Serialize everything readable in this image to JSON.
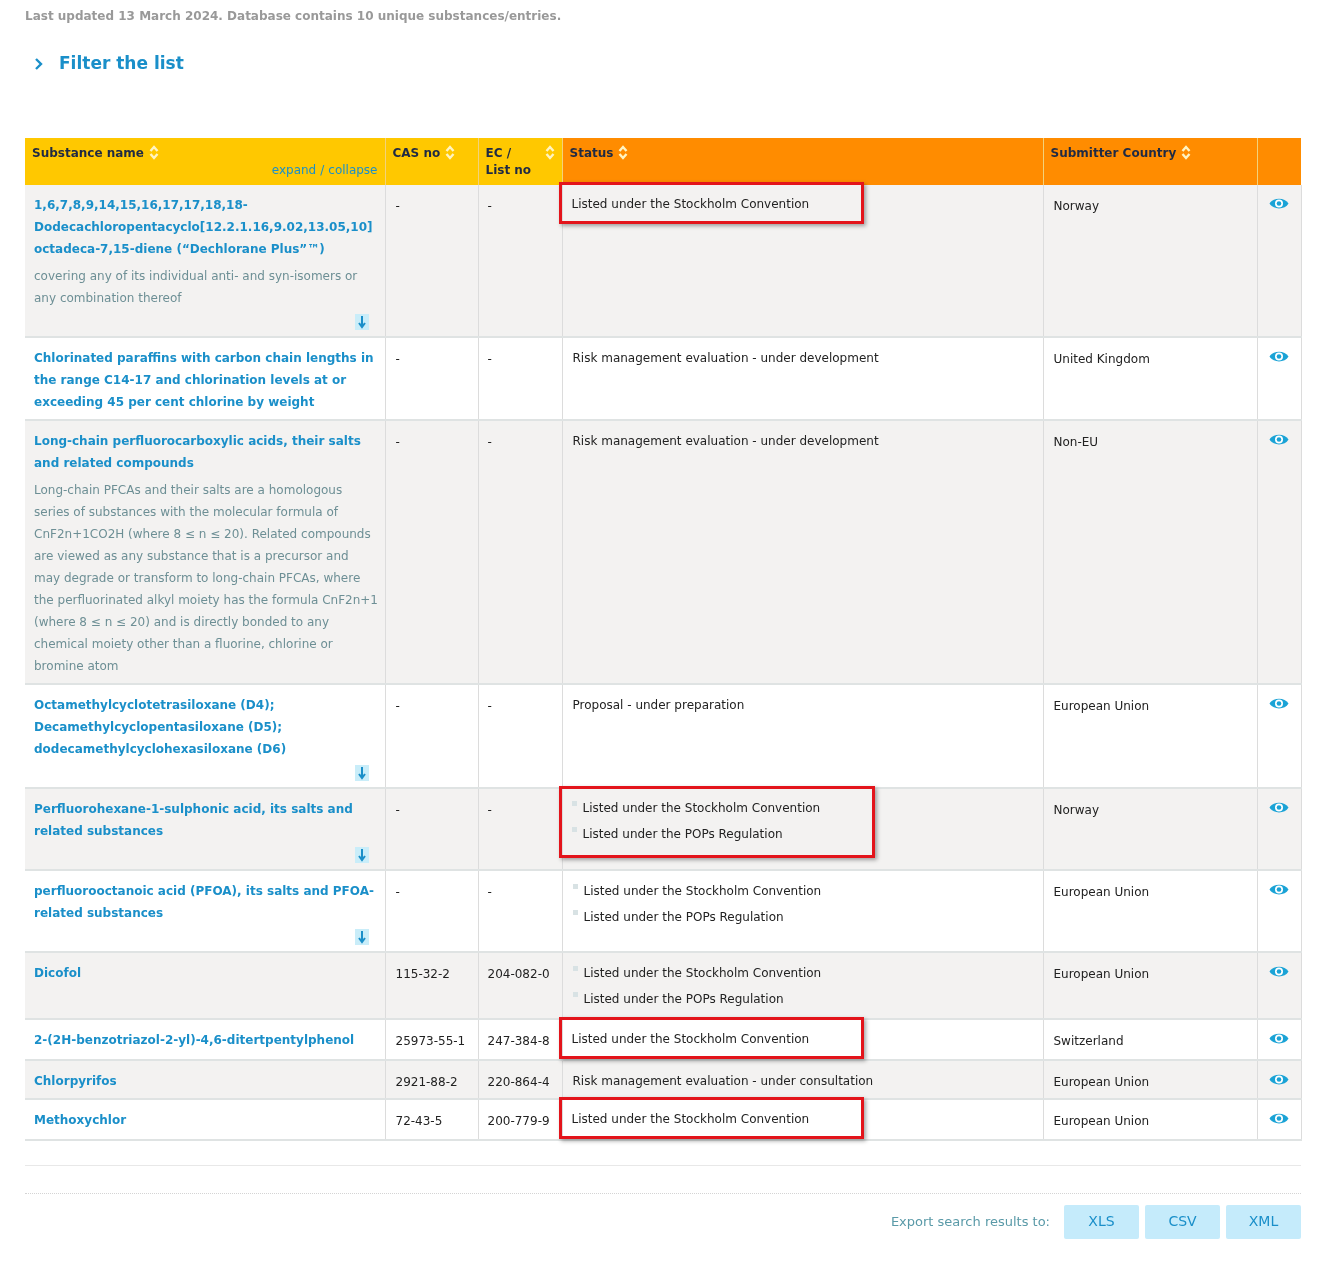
{
  "update_note": "Last updated 13 March 2024. Database contains 10 unique substances/entries.",
  "filter": {
    "label": "Filter the list",
    "expanded": false
  },
  "table": {
    "columns": [
      {
        "label": "Substance name",
        "kind": "name",
        "color": "#ffc800",
        "sortable": true
      },
      {
        "label": "CAS no",
        "kind": "cas",
        "color": "#ffc800",
        "sortable": true
      },
      {
        "label": "EC / List no",
        "kind": "ec",
        "color": "#ffc800",
        "sortable": true
      },
      {
        "label": "Status",
        "kind": "status",
        "color": "#ff8c00",
        "sortable": true
      },
      {
        "label": "Submitter Country",
        "kind": "country",
        "color": "#ff8c00",
        "sortable": true
      }
    ],
    "expand_link": "expand",
    "separator": "/",
    "collapse_link": "collapse",
    "rows": [
      {
        "name": "1,6,7,8,9,14,15,16,17,17,18,18-Dodecachloropentacyclo[12.2.1.16,9.02,13.05,10]octadeca-7,15-diene (“Dechlorane Plus”™)",
        "description": "covering any of its individual anti- and syn-isomers or any combination thereof",
        "has_more": true,
        "cas": "-",
        "ec": "-",
        "status": [
          "Listed under the Stockholm Convention"
        ],
        "highlighted": true,
        "country": "Norway"
      },
      {
        "name": "Chlorinated paraffins with carbon chain lengths in the range C14-17 and chlorination levels at or exceeding 45 per cent chlorine by weight",
        "has_more": false,
        "cas": "-",
        "ec": "-",
        "status": [
          "Risk management evaluation - under development"
        ],
        "highlighted": false,
        "country": "United Kingdom"
      },
      {
        "name": "Long-chain perfluorocarboxylic acids, their salts and related compounds",
        "description": "Long-chain PFCAs and their salts are a homologous series of substances with the molecular formula of CnF2n+1CO2H (where 8 ≤ n ≤ 20). Related compounds are viewed as any substance that is a precursor and may degrade or transform to long-chain PFCAs, where the perfluorinated alkyl moiety has the formula CnF2n+1 (where 8 ≤ n ≤ 20) and is directly bonded to any chemical moiety other than a fluorine, chlorine or bromine atom",
        "has_more": false,
        "cas": "-",
        "ec": "-",
        "status": [
          "Risk management evaluation - under development"
        ],
        "highlighted": false,
        "country": "Non-EU"
      },
      {
        "name": "Octamethylcyclotetrasiloxane (D4); Decamethylcyclopentasiloxane (D5); dodecamethylcyclohexasiloxane (D6)",
        "has_more": true,
        "cas": "-",
        "ec": "-",
        "status": [
          "Proposal - under preparation"
        ],
        "highlighted": false,
        "country": "European Union"
      },
      {
        "name": "Perfluorohexane-1-sulphonic acid, its salts and related substances",
        "has_more": true,
        "cas": "-",
        "ec": "-",
        "status": [
          "Listed under the Stockholm Convention",
          "Listed under the POPs Regulation"
        ],
        "highlighted": true,
        "country": "Norway"
      },
      {
        "name": "perfluorooctanoic acid (PFOA), its salts and PFOA-related substances",
        "has_more": true,
        "cas": "-",
        "ec": "-",
        "status": [
          "Listed under the Stockholm Convention",
          "Listed under the POPs Regulation"
        ],
        "highlighted": false,
        "country": "European Union"
      },
      {
        "name": "Dicofol",
        "has_more": false,
        "cas": "115-32-2",
        "ec": "204-082-0",
        "status": [
          "Listed under the Stockholm Convention",
          "Listed under the POPs Regulation"
        ],
        "highlighted": false,
        "country": "European Union"
      },
      {
        "name": "2-(2H-benzotriazol-2-yl)-4,6-ditertpentylphenol",
        "has_more": false,
        "cas": "25973-55-1",
        "ec": "247-384-8",
        "status": [
          "Listed under the Stockholm Convention"
        ],
        "highlighted": true,
        "country": "Switzerland"
      },
      {
        "name": "Chlorpyrifos",
        "has_more": false,
        "cas": "2921-88-2",
        "ec": "220-864-4",
        "status": [
          "Risk management evaluation - under consultation"
        ],
        "highlighted": false,
        "country": "European Union"
      },
      {
        "name": "Methoxychlor",
        "has_more": false,
        "cas": "72-43-5",
        "ec": "200-779-9",
        "status": [
          "Listed under the Stockholm Convention"
        ],
        "highlighted": true,
        "country": "European Union"
      }
    ]
  },
  "export": {
    "label": "Export search results to:",
    "buttons": [
      "XLS",
      "CSV",
      "XML"
    ]
  }
}
